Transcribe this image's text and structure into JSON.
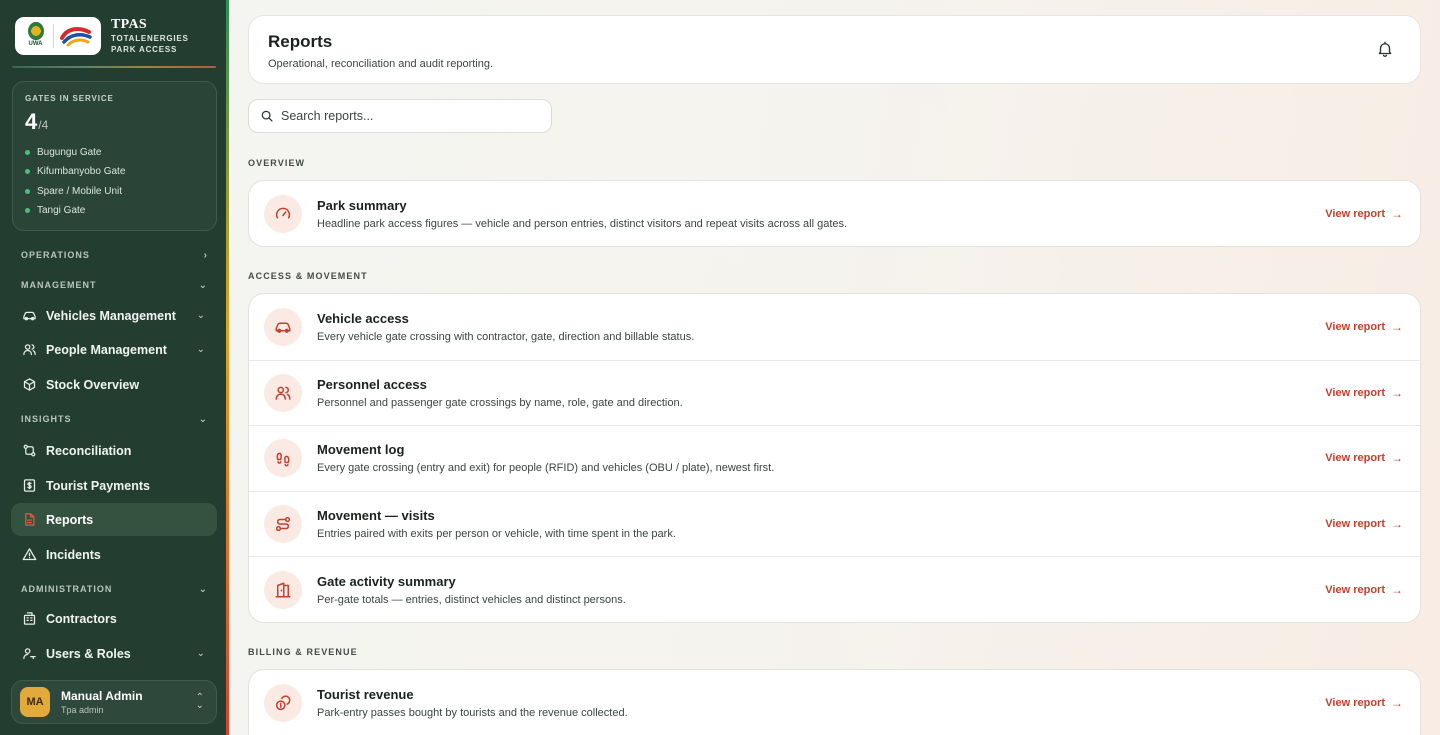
{
  "brand": {
    "title": "TPAS",
    "subtitle_line1": "TOTALENERGIES",
    "subtitle_line2": "PARK ACCESS",
    "uwa_logo_text": "UWA"
  },
  "gates": {
    "label": "GATES IN SERVICE",
    "active": "4",
    "total": "/4",
    "items": [
      {
        "name": "Bugungu Gate"
      },
      {
        "name": "Kifumbanyobo Gate"
      },
      {
        "name": "Spare / Mobile Unit"
      },
      {
        "name": "Tangi Gate"
      }
    ]
  },
  "nav": {
    "operations": "OPERATIONS",
    "management": "MANAGEMENT",
    "vehicles": "Vehicles Management",
    "people": "People Management",
    "stock": "Stock Overview",
    "insights": "INSIGHTS",
    "reconciliation": "Reconciliation",
    "tourist_payments": "Tourist Payments",
    "reports": "Reports",
    "incidents": "Incidents",
    "administration": "ADMINISTRATION",
    "contractors": "Contractors",
    "users_roles": "Users & Roles"
  },
  "user": {
    "initials": "MA",
    "name": "Manual Admin",
    "role": "Tpa admin"
  },
  "header": {
    "title": "Reports",
    "subtitle": "Operational, reconciliation and audit reporting."
  },
  "search": {
    "placeholder": "Search reports..."
  },
  "sections": {
    "overview": "OVERVIEW",
    "access": "ACCESS & MOVEMENT",
    "billing": "BILLING & REVENUE"
  },
  "reports": {
    "view_label": "View report",
    "overview": [
      {
        "title": "Park summary",
        "desc": "Headline park access figures — vehicle and person entries, distinct visitors and repeat visits across all gates."
      }
    ],
    "access": [
      {
        "title": "Vehicle access",
        "desc": "Every vehicle gate crossing with contractor, gate, direction and billable status."
      },
      {
        "title": "Personnel access",
        "desc": "Personnel and passenger gate crossings by name, role, gate and direction."
      },
      {
        "title": "Movement log",
        "desc": "Every gate crossing (entry and exit) for people (RFID) and vehicles (OBU / plate), newest first."
      },
      {
        "title": "Movement — visits",
        "desc": "Entries paired with exits per person or vehicle, with time spent in the park."
      },
      {
        "title": "Gate activity summary",
        "desc": "Per-gate totals — entries, distinct vehicles and distinct persons."
      }
    ],
    "billing": [
      {
        "title": "Tourist revenue",
        "desc": "Park-entry passes bought by tourists and the revenue collected."
      }
    ]
  },
  "colors": {
    "sidebar_bg": "#233d31",
    "accent_red": "#c2412f",
    "icon_bg": "#fbe9e3",
    "gate_dot": "#4fbf77"
  }
}
